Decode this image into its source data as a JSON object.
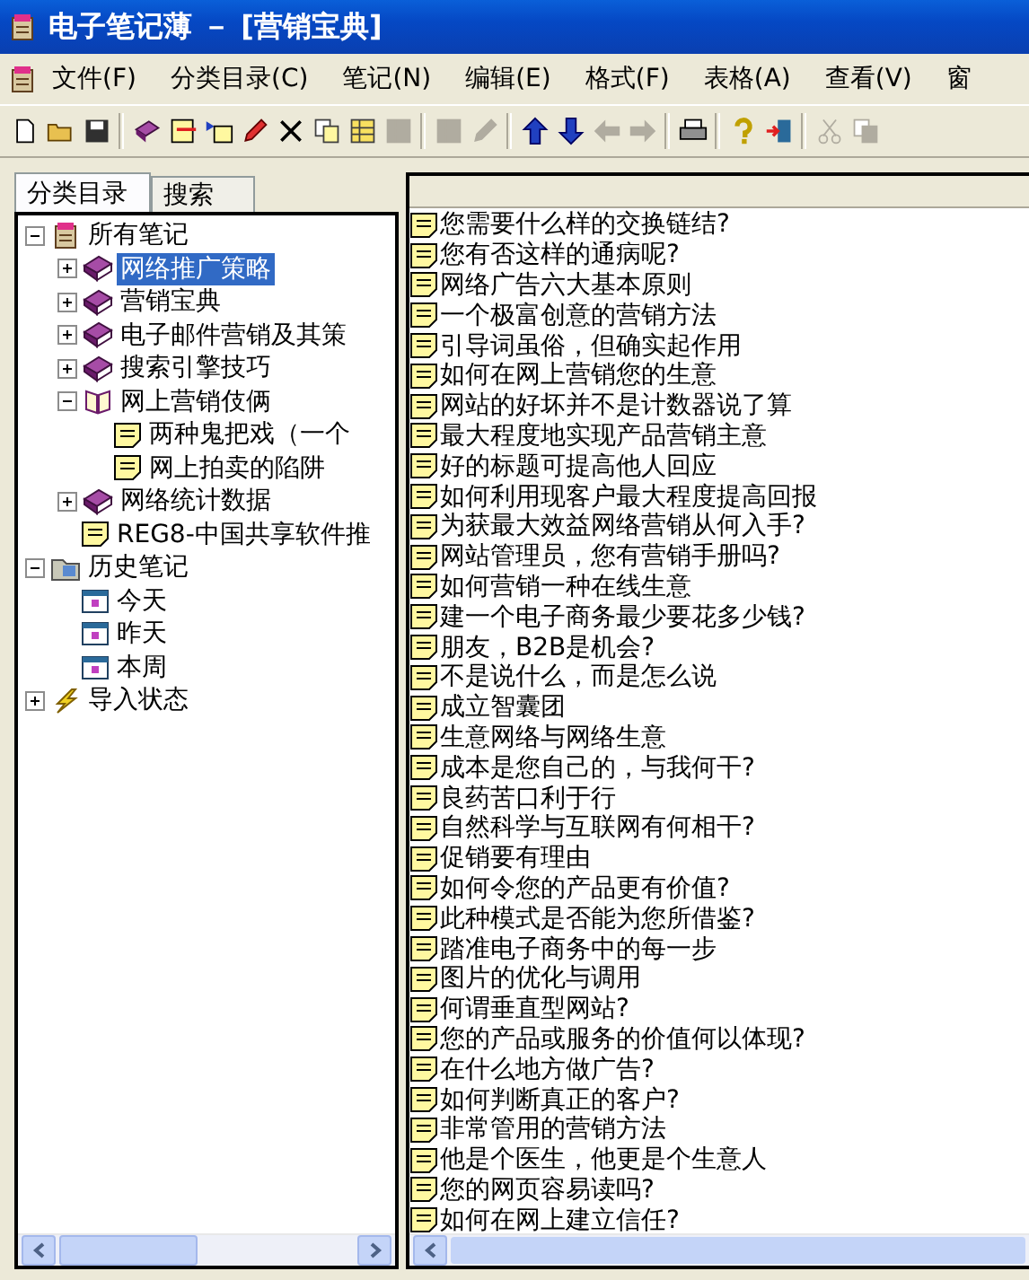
{
  "window": {
    "title": "电子笔记薄 － [营销宝典]"
  },
  "menu": [
    "文件(F)",
    "分类目录(C)",
    "笔记(N)",
    "编辑(E)",
    "格式(F)",
    "表格(A)",
    "查看(V)",
    "窗"
  ],
  "toolbar": [
    {
      "kind": "new",
      "disabled": false
    },
    {
      "kind": "open",
      "disabled": false
    },
    {
      "kind": "save",
      "disabled": false
    },
    {
      "kind": "separator"
    },
    {
      "kind": "book",
      "disabled": false
    },
    {
      "kind": "note-line",
      "disabled": false
    },
    {
      "kind": "list",
      "disabled": false
    },
    {
      "kind": "pencil",
      "disabled": false
    },
    {
      "kind": "delete",
      "disabled": false
    },
    {
      "kind": "copy",
      "disabled": false
    },
    {
      "kind": "grid",
      "disabled": false
    },
    {
      "kind": "grid",
      "disabled": true
    },
    {
      "kind": "separator"
    },
    {
      "kind": "grid",
      "disabled": true
    },
    {
      "kind": "pencil",
      "disabled": true
    },
    {
      "kind": "separator"
    },
    {
      "kind": "up",
      "disabled": false
    },
    {
      "kind": "down",
      "disabled": false
    },
    {
      "kind": "left",
      "disabled": true
    },
    {
      "kind": "right",
      "disabled": true
    },
    {
      "kind": "separator"
    },
    {
      "kind": "print",
      "disabled": false
    },
    {
      "kind": "separator"
    },
    {
      "kind": "help",
      "disabled": false
    },
    {
      "kind": "exit",
      "disabled": false
    },
    {
      "kind": "separator"
    },
    {
      "kind": "cut",
      "disabled": true
    },
    {
      "kind": "copy",
      "disabled": true
    }
  ],
  "tabs": [
    {
      "label": "分类目录",
      "selected": true
    },
    {
      "label": "搜索",
      "selected": false
    }
  ],
  "tree": [
    {
      "label": "所有笔记",
      "kind": "root",
      "expanded": true,
      "selected": false,
      "children": [
        {
          "label": "网络推广策略",
          "kind": "book",
          "expanded": false,
          "selected": true
        },
        {
          "label": "营销宝典",
          "kind": "book",
          "expanded": false,
          "selected": false
        },
        {
          "label": "电子邮件营销及其策",
          "kind": "book",
          "expanded": false,
          "selected": false
        },
        {
          "label": "搜索引擎技巧",
          "kind": "book",
          "expanded": false,
          "selected": false
        },
        {
          "label": "网上营销伎俩",
          "kind": "open-book",
          "expanded": true,
          "selected": false,
          "children": [
            {
              "label": "两种鬼把戏（一个",
              "kind": "note",
              "selected": false
            },
            {
              "label": "网上拍卖的陷阱",
              "kind": "note",
              "selected": false
            }
          ]
        },
        {
          "label": "网络统计数据",
          "kind": "book",
          "expanded": false,
          "selected": false
        },
        {
          "label": "REG8-中国共享软件推",
          "kind": "note",
          "selected": false
        }
      ]
    },
    {
      "label": "历史笔记",
      "kind": "history",
      "expanded": true,
      "selected": false,
      "children": [
        {
          "label": "今天",
          "kind": "calendar",
          "selected": false
        },
        {
          "label": "昨天",
          "kind": "calendar",
          "selected": false
        },
        {
          "label": "本周",
          "kind": "calendar",
          "selected": false
        }
      ]
    },
    {
      "label": "导入状态",
      "kind": "import",
      "expanded": false,
      "selected": false
    }
  ],
  "notes": [
    "您需要什么样的交换链结?",
    "您有否这样的通病呢?",
    "网络广告六大基本原则",
    "一个极富创意的营销方法",
    "引导词虽俗，但确实起作用",
    "如何在网上营销您的生意",
    "网站的好坏并不是计数器说了算",
    "最大程度地实现产品营销主意",
    "好的标题可提高他人回应",
    "如何利用现客户最大程度提高回报",
    "为获最大效益网络营销从何入手?",
    "网站管理员，您有营销手册吗?",
    "如何营销一种在线生意",
    "建一个电子商务最少要花多少钱?",
    "朋友，B2B是机会?",
    "不是说什么，而是怎么说",
    "成立智囊团",
    "生意网络与网络生意",
    "成本是您自己的，与我何干?",
    "良药苦口利于行",
    "自然科学与互联网有何相干?",
    "促销要有理由",
    "如何令您的产品更有价值?",
    "此种模式是否能为您所借鉴?",
    "踏准电子商务中的每一步",
    "图片的优化与调用",
    "何谓垂直型网站?",
    "您的产品或服务的价值何以体现?",
    "在什么地方做广告?",
    "如何判断真正的客户?",
    "非常管用的营销方法",
    "他是个医生，他更是个生意人",
    "您的网页容易读吗?",
    "如何在网上建立信任?"
  ]
}
